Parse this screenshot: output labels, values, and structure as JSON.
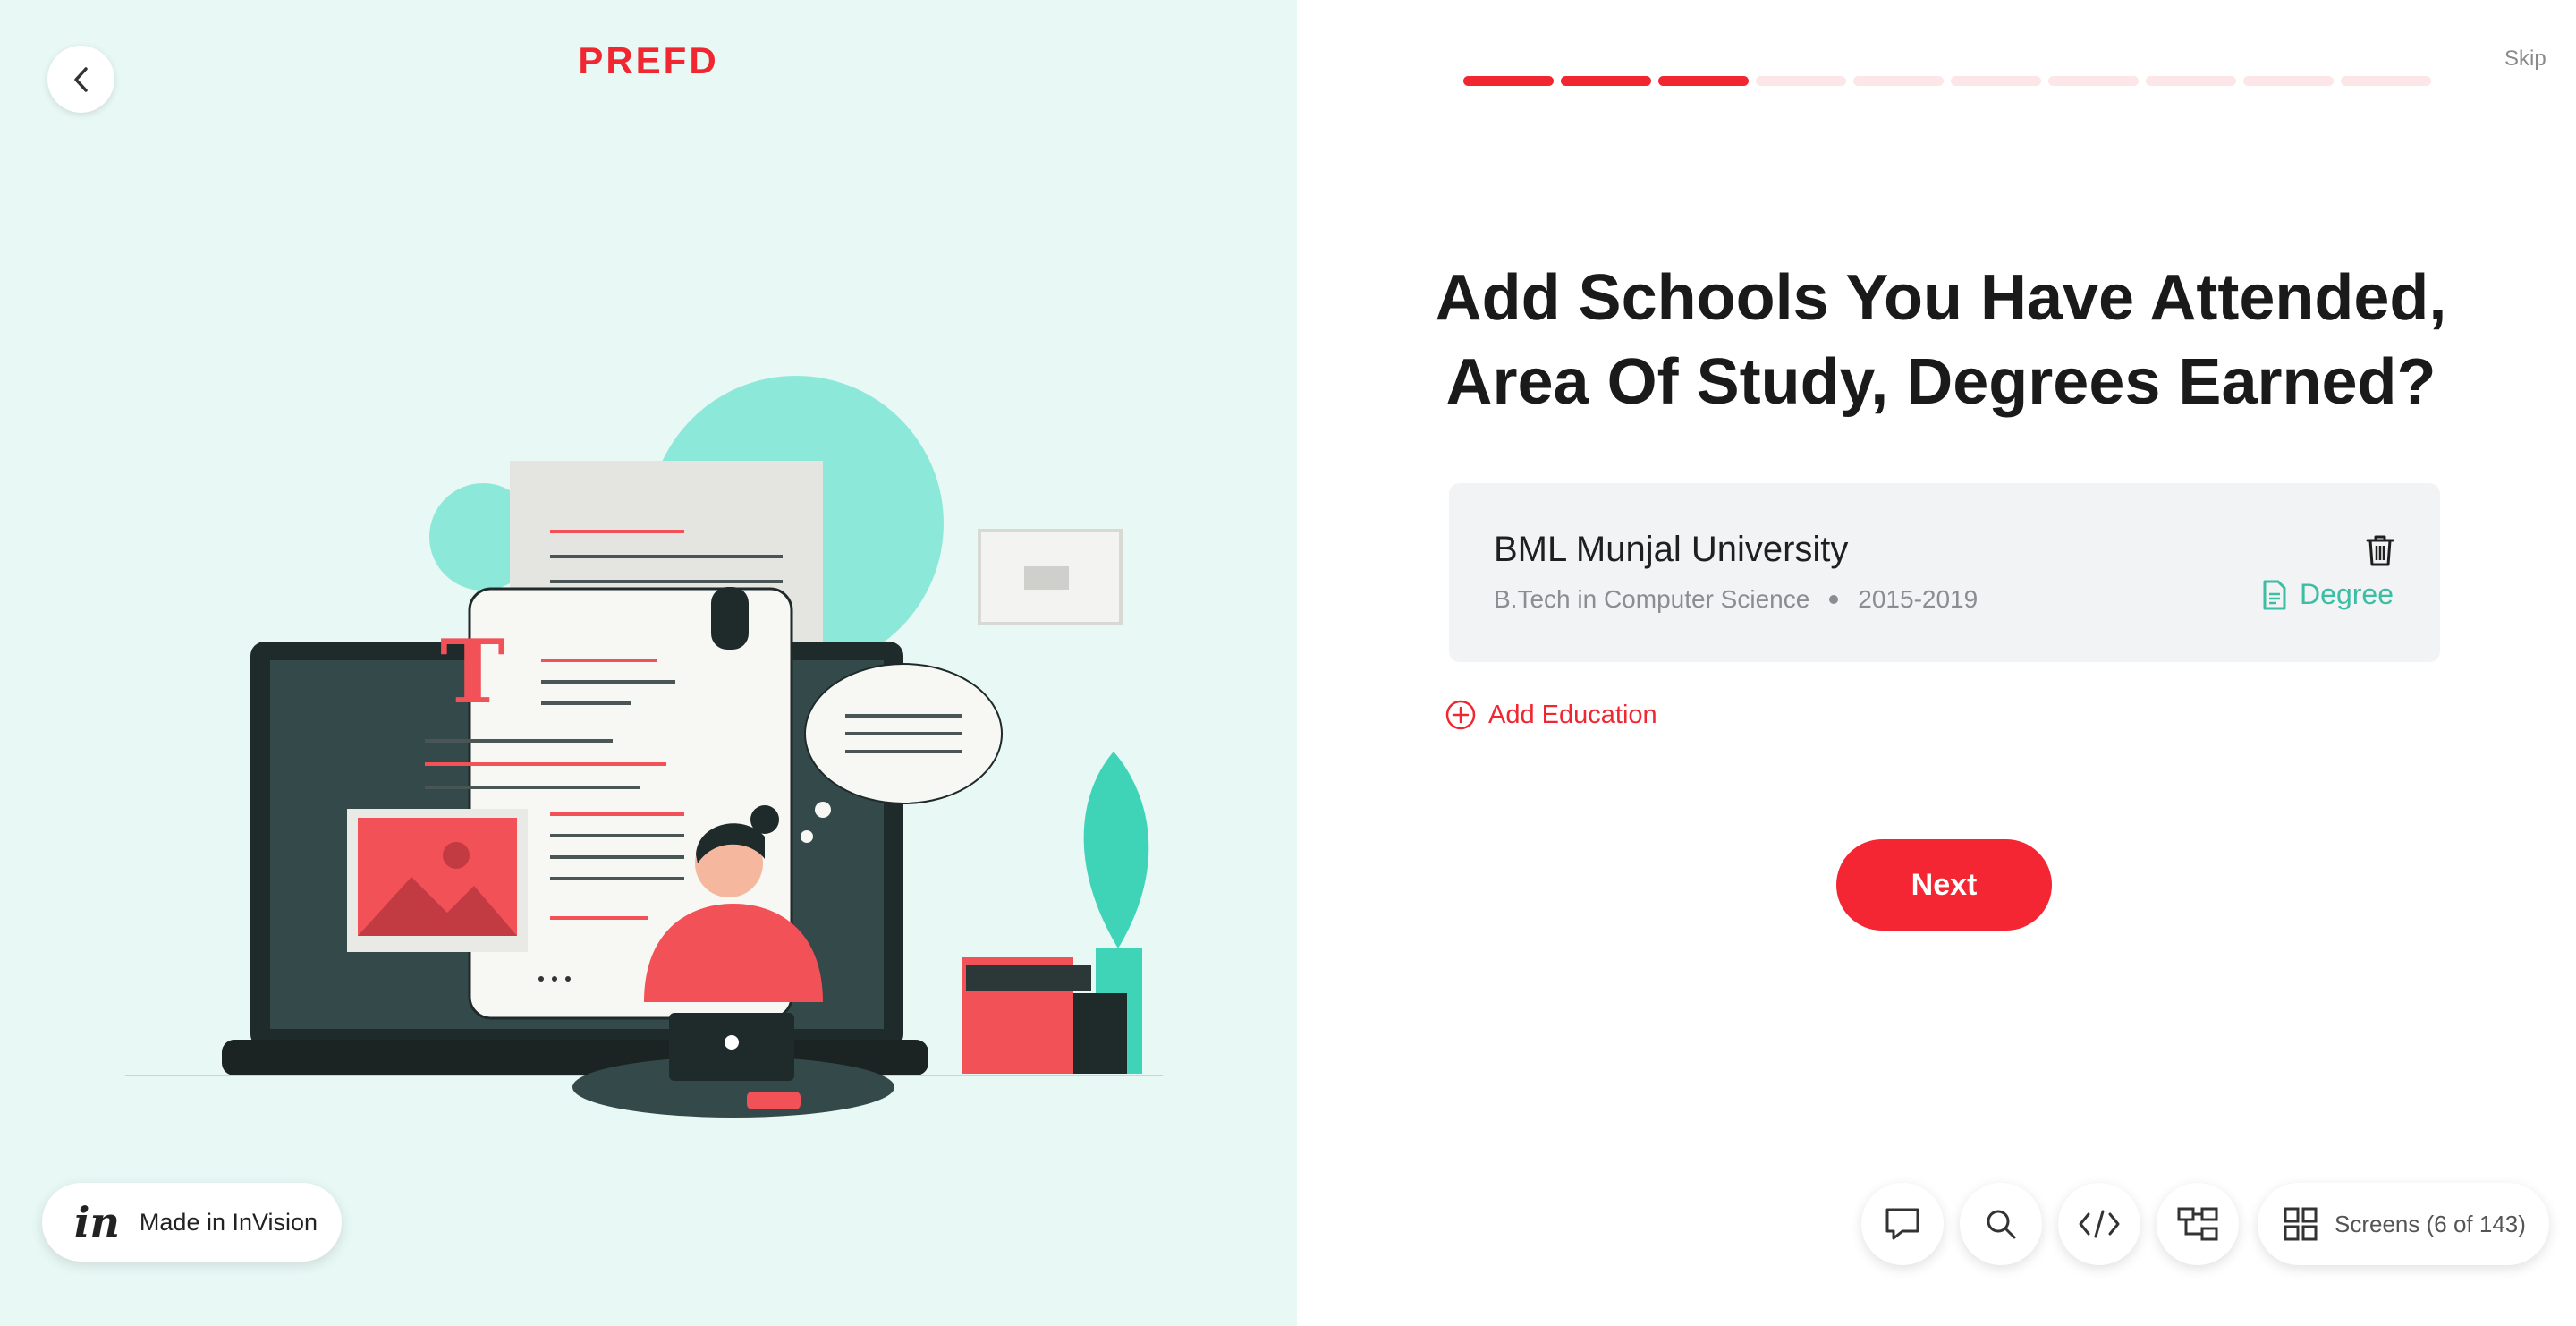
{
  "brand": {
    "logo": "PREFD",
    "accent": "#f02630",
    "teal": "#3dbda4"
  },
  "header": {
    "back_icon": "chevron-left-icon",
    "skip_label": "Skip"
  },
  "progress": {
    "total_steps": 10,
    "completed_steps": 3
  },
  "main": {
    "headline": "Add Schools You Have Attended, Area Of Study, Degrees Earned?",
    "education": [
      {
        "school": "BML Munjal University",
        "program": "B.Tech in Computer Science",
        "years": "2015-2019",
        "document_label": "Degree"
      }
    ],
    "add_label": "Add Education",
    "next_label": "Next"
  },
  "footer": {
    "invision_logo": "in",
    "invision_label": "Made in InVision",
    "tools": [
      "comment-icon",
      "search-icon",
      "code-icon",
      "flow-icon"
    ],
    "screens_label": "Screens (6 of 143)"
  }
}
